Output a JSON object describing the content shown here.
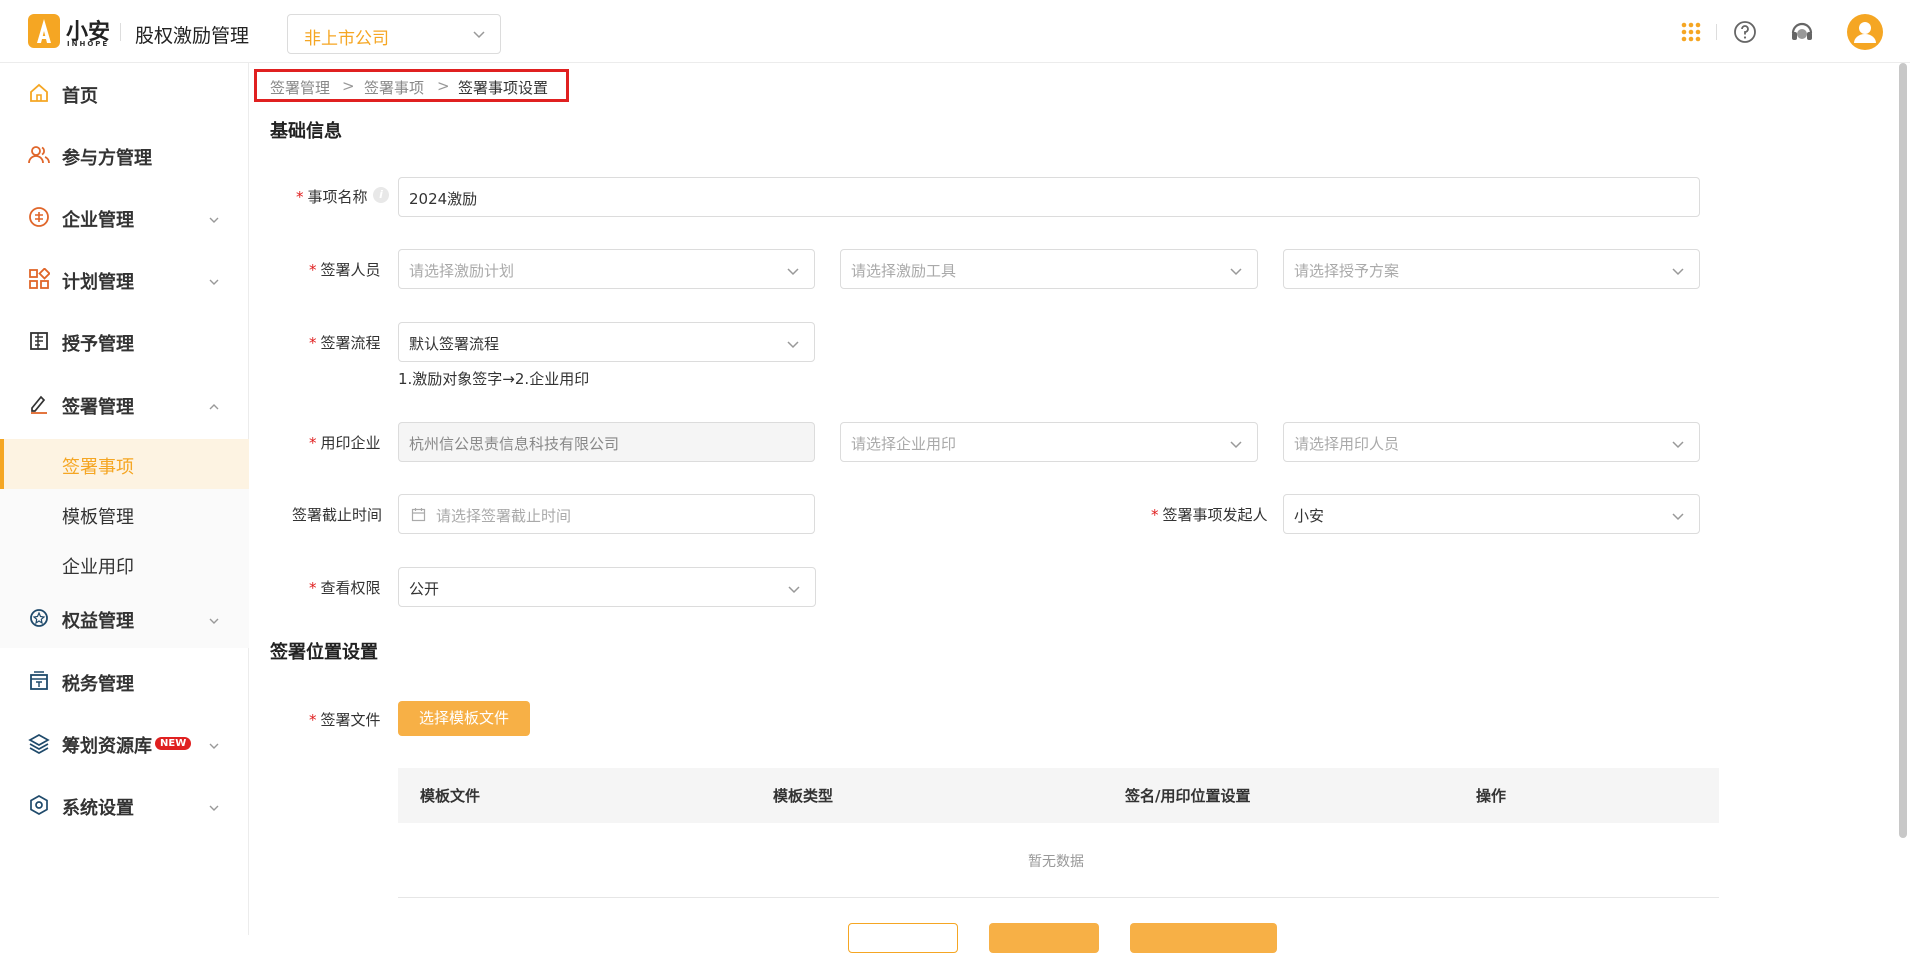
{
  "header": {
    "logo_text": "小安",
    "logo_sub": "INHOPE",
    "app_title": "股权激励管理",
    "company_select": "非上市公司"
  },
  "sidebar": {
    "items": [
      {
        "label": "首页",
        "icon": "home-icon"
      },
      {
        "label": "参与方管理",
        "icon": "users-icon"
      },
      {
        "label": "企业管理",
        "icon": "enterprise-icon"
      },
      {
        "label": "计划管理",
        "icon": "grid-icon"
      },
      {
        "label": "授予管理",
        "icon": "book-icon"
      },
      {
        "label": "签署管理",
        "icon": "sign-icon"
      },
      {
        "label": "权益管理",
        "icon": "badge-icon"
      },
      {
        "label": "税务管理",
        "icon": "tax-icon"
      },
      {
        "label": "筹划资源库",
        "icon": "layers-icon",
        "badge": "NEW"
      },
      {
        "label": "系统设置",
        "icon": "settings-icon"
      }
    ],
    "sub_items": [
      "签署事项",
      "模板管理",
      "企业用印"
    ]
  },
  "breadcrumb": [
    "签署管理",
    "签署事项",
    "签署事项设置"
  ],
  "form": {
    "section_basic": "基础信息",
    "name_label": "事项名称",
    "name_value": "2024激励",
    "signer_label": "签署人员",
    "signer_plan_ph": "请选择激励计划",
    "signer_tool_ph": "请选择激励工具",
    "signer_scheme_ph": "请选择授予方案",
    "flow_label": "签署流程",
    "flow_value": "默认签署流程",
    "flow_hint": "1.激励对象签字→2.企业用印",
    "seal_label": "用印企业",
    "seal_company": "杭州信公思责信息科技有限公司",
    "seal_choose_ph": "请选择企业用印",
    "seal_person_ph": "请选择用印人员",
    "deadline_label": "签署截止时间",
    "deadline_ph": "请选择签署截止时间",
    "initiator_label": "签署事项发起人",
    "initiator_value": "小安",
    "permission_label": "查看权限",
    "permission_value": "公开",
    "section_position": "签署位置设置",
    "file_label": "签署文件",
    "choose_template_btn": "选择模板文件"
  },
  "table": {
    "headers": [
      "模板文件",
      "模板类型",
      "签名/用印位置设置",
      "操作"
    ],
    "empty_text": "暂无数据"
  },
  "colors": {
    "accent": "#f5a623",
    "required": "#e02020"
  }
}
